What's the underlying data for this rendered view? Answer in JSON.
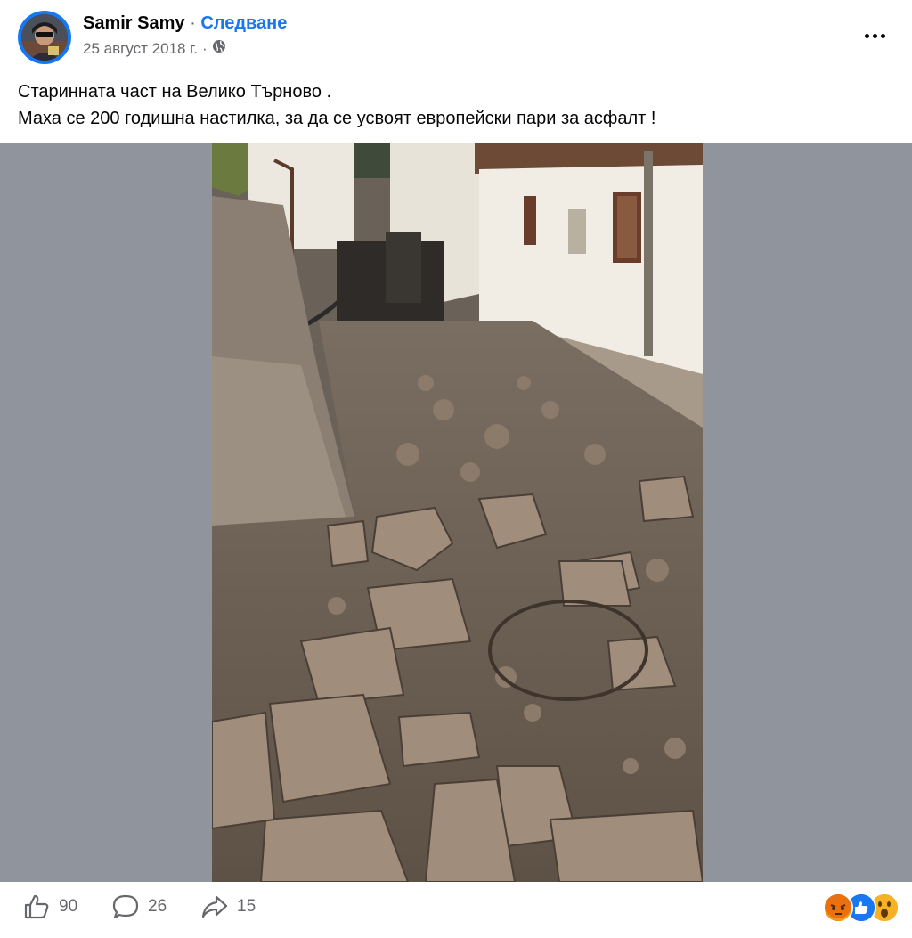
{
  "post": {
    "author": "Samir Samy",
    "separator": "·",
    "follow_label": "Следване",
    "date": "25 август 2018 г.",
    "date_separator": "·",
    "audience_icon": "globe-icon",
    "more_icon": "more-horizontal-icon",
    "text_lines": [
      "Старинната част на Велико Търново .",
      "Маха се 200 годишна настилка, за да се усвоят европейски пари за асфалт !"
    ]
  },
  "media": {
    "description_icon": "photo",
    "background_color": "#90949c"
  },
  "footer": {
    "likes": "90",
    "comments": "26",
    "shares": "15",
    "like_icon": "thumbs-up-icon",
    "comment_icon": "comment-bubble-icon",
    "share_icon": "share-arrow-icon",
    "reactions": [
      "angry",
      "like",
      "wow"
    ]
  },
  "colors": {
    "accent": "#1877f2",
    "secondary_text": "#65676b",
    "angry": "#e9710f",
    "wow": "#f7b125"
  }
}
